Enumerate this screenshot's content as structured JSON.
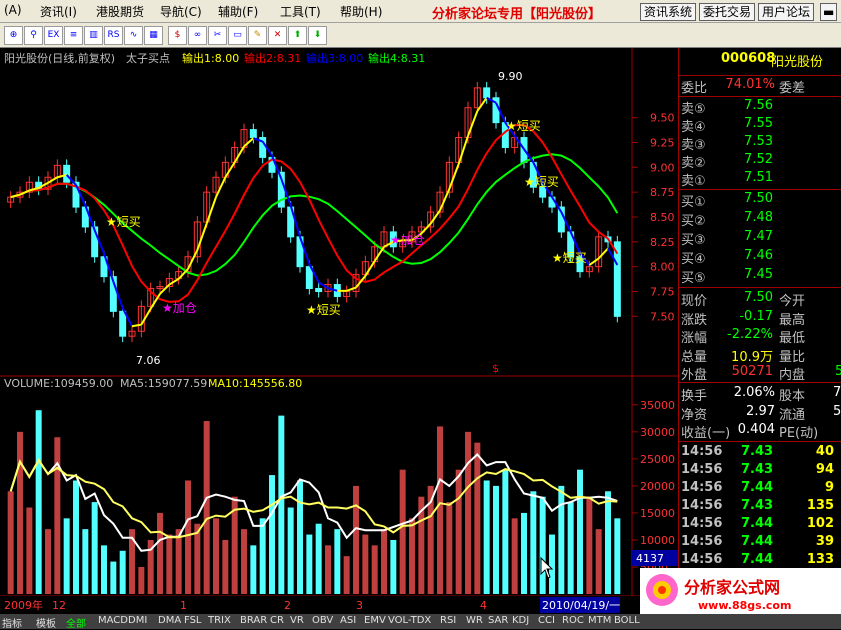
{
  "menu": [
    {
      "id": "menu-a",
      "label": "(A)"
    },
    {
      "id": "menu-zixun",
      "label": "资讯(I)"
    },
    {
      "id": "menu-ganggu",
      "label": "港股期货"
    },
    {
      "id": "menu-daohang",
      "label": "导航(C)"
    },
    {
      "id": "menu-fuzhu",
      "label": "辅助(F)"
    },
    {
      "id": "menu-gongju",
      "label": "工具(T)"
    },
    {
      "id": "menu-bangzhu",
      "label": "帮助(H)"
    }
  ],
  "brand": "分析家论坛专用【阳光股份】",
  "top_buttons": [
    "资讯系统",
    "委托交易",
    "用户论坛"
  ],
  "chart": {
    "title_stock": "阳光股份(日线,前复权)",
    "indicator_name": "太子买点",
    "out1": "输出1:8.00",
    "out2": "输出2:8.31",
    "out3": "输出3:8.00",
    "out4": "输出4:8.31",
    "annotations": {
      "high": "9.90",
      "low": "7.06",
      "buy1": "★短买",
      "add1": "★加仓",
      "buy2": "★短买",
      "add2": "★加仓",
      "buy3": "★短买",
      "buy4": "★短买",
      "buy5": "★短买"
    },
    "volume_header": "VOLUME:109459.00",
    "ma5_header": "MA5:159077.59",
    "ma10_header": "MA10:145556.80",
    "marker_s": "$",
    "cursor_value": "4137",
    "x_labels": [
      "2009年",
      "12",
      "1",
      "2",
      "3",
      "4"
    ],
    "date_box": "2010/04/19/一",
    "colors": {
      "up": "#ff3232",
      "down": "#54ffff",
      "ma_yellow": "#ffff00",
      "ma_red": "#ff0000",
      "ma_green": "#00ff00",
      "ma_blue": "#0000ff"
    }
  },
  "chart_data": [
    {
      "type": "line",
      "name_label": "price",
      "y_ticks": [
        7.5,
        7.75,
        8.0,
        8.25,
        8.5,
        8.75,
        9.0,
        9.25,
        9.5
      ],
      "ylim": [
        7.0,
        10.0
      ],
      "close": [
        8.7,
        8.75,
        8.85,
        8.78,
        8.9,
        9.02,
        8.85,
        8.6,
        8.4,
        8.1,
        7.9,
        7.55,
        7.3,
        7.35,
        7.6,
        7.78,
        7.8,
        7.88,
        7.95,
        8.1,
        8.45,
        8.75,
        8.9,
        9.05,
        9.2,
        9.38,
        9.3,
        9.1,
        8.95,
        8.6,
        8.3,
        8.0,
        7.78,
        7.75,
        7.82,
        7.7,
        7.75,
        7.92,
        8.05,
        8.2,
        8.35,
        8.2,
        8.25,
        8.35,
        8.4,
        8.55,
        8.75,
        9.05,
        9.3,
        9.6,
        9.8,
        9.7,
        9.45,
        9.2,
        9.3,
        9.05,
        8.8,
        8.7,
        8.6,
        8.35,
        8.1,
        7.95,
        8.0,
        8.3,
        8.25,
        7.5
      ]
    },
    {
      "type": "bar",
      "name_label": "volume",
      "y_ticks": [
        5000,
        10000,
        15000,
        20000,
        25000,
        30000,
        35000
      ],
      "ylim": [
        0,
        37000
      ],
      "values": [
        19000,
        30000,
        16000,
        34000,
        12000,
        29000,
        14000,
        21000,
        12000,
        17000,
        9000,
        6000,
        8000,
        12000,
        5000,
        10000,
        15000,
        11000,
        12000,
        21000,
        13000,
        32000,
        14000,
        10000,
        18000,
        12000,
        9000,
        14000,
        22000,
        33000,
        16000,
        21000,
        11000,
        13000,
        9000,
        12000,
        7000,
        20000,
        11000,
        9000,
        12000,
        10000,
        23000,
        14000,
        18000,
        20000,
        31000,
        17000,
        23000,
        30000,
        28000,
        21000,
        20000,
        23000,
        14000,
        15000,
        19000,
        18000,
        11000,
        20000,
        17000,
        23000,
        18000,
        12000,
        19000,
        14000
      ]
    }
  ],
  "quote": {
    "code": "000608",
    "name": "阳光股份",
    "weibi_label": "委比",
    "weibi_value": "74.01%",
    "weicha_label": "委差",
    "sell": [
      {
        "label": "卖⑤",
        "price": "7.56"
      },
      {
        "label": "卖④",
        "price": "7.55"
      },
      {
        "label": "卖③",
        "price": "7.53"
      },
      {
        "label": "卖②",
        "price": "7.52"
      },
      {
        "label": "卖①",
        "price": "7.51"
      }
    ],
    "buy": [
      {
        "label": "买①",
        "price": "7.50"
      },
      {
        "label": "买②",
        "price": "7.48"
      },
      {
        "label": "买③",
        "price": "7.47"
      },
      {
        "label": "买④",
        "price": "7.46"
      },
      {
        "label": "买⑤",
        "price": "7.45"
      }
    ],
    "stats": [
      {
        "l": "现价",
        "v": "7.50",
        "r": "今开",
        "c": "#00ff00"
      },
      {
        "l": "涨跌",
        "v": "-0.17",
        "r": "最高",
        "c": "#00ff00"
      },
      {
        "l": "涨幅",
        "v": "-2.22%",
        "r": "最低",
        "c": "#00ff00"
      },
      {
        "l": "总量",
        "v": "10.9万",
        "r": "量比",
        "c": "#ffff00"
      },
      {
        "l": "外盘",
        "v": "50271",
        "r": "内盘",
        "c": "#ff3232"
      }
    ],
    "neipan_partial": "5",
    "fin": [
      {
        "l": "换手",
        "v": "2.06%",
        "r": "股本",
        "rv": "7"
      },
      {
        "l": "净资",
        "v": "2.97",
        "r": "流通",
        "rv": "5"
      },
      {
        "l": "收益(一)",
        "v": "0.404",
        "r": "PE(动)",
        "rv": ""
      }
    ],
    "ticks": [
      {
        "t": "14:56",
        "p": "7.43",
        "q": "40"
      },
      {
        "t": "14:56",
        "p": "7.43",
        "q": "94"
      },
      {
        "t": "14:56",
        "p": "7.44",
        "q": "9"
      },
      {
        "t": "14:56",
        "p": "7.43",
        "q": "135"
      },
      {
        "t": "14:56",
        "p": "7.44",
        "q": "102"
      },
      {
        "t": "14:56",
        "p": "7.44",
        "q": "39"
      },
      {
        "t": "14:56",
        "p": "7.44",
        "q": "133"
      }
    ]
  },
  "logo": {
    "title": "分析家公式网",
    "url": "www.88gs.com"
  },
  "tabs": [
    "指标",
    "模板",
    "全部",
    "MACD",
    "DMI",
    "DMA",
    "FSL",
    "TRIX",
    "BRAR",
    "CR",
    "VR",
    "OBV",
    "ASI",
    "EMV",
    "VOL-TDX",
    "RSI",
    "WR",
    "SAR",
    "KDJ",
    "CCI",
    "ROC",
    "MTM",
    "BOLL"
  ]
}
